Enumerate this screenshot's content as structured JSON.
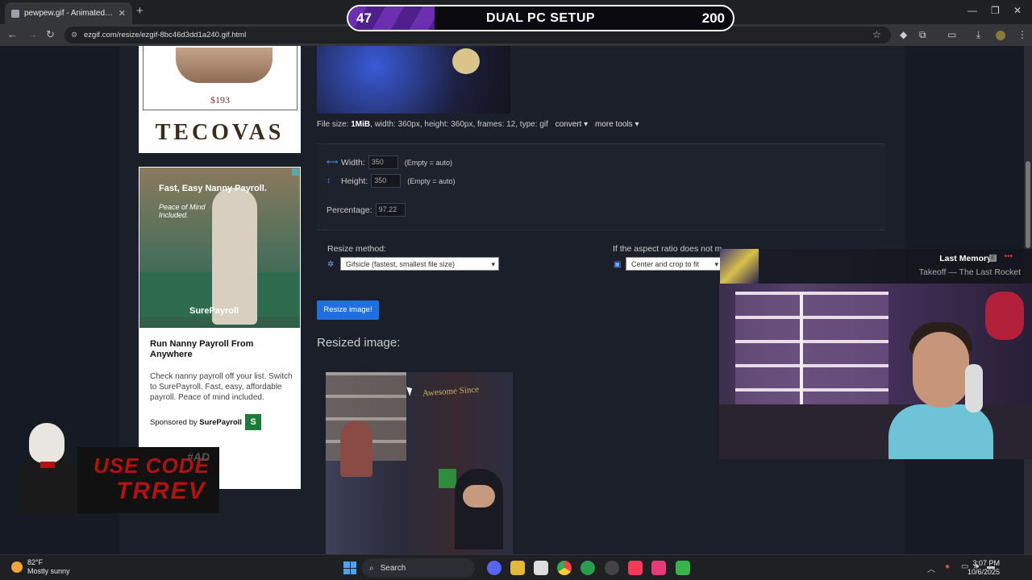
{
  "browser": {
    "tab_title": "pewpew.gif - Animated image",
    "url": "ezgif.com/resize/ezgif-8bc46d3dd1a240.gif.html",
    "newtab_glyph": "+",
    "close_glyph": "✕"
  },
  "stream_overlay": {
    "left_score": "47",
    "title": "DUAL PC SETUP",
    "right_score": "200",
    "progress": 0.225
  },
  "ads": {
    "boot_price": "$193",
    "tecovas": "TECOVAS",
    "surepayroll_headline": "Fast, Easy Nanny Payroll.",
    "surepayroll_sub": "Peace of Mind Included.",
    "surepayroll_brand": "SurePayroll",
    "card_title": "Run Nanny Payroll From Anywhere",
    "card_body": "Check nanny payroll off your list. Switch to SurePayroll. Fast, easy, affordable payroll. Peace of mind included.",
    "sponsored_prefix": "Sponsored by",
    "sponsored_brand": "SurePayroll"
  },
  "file_info": {
    "prefix": "File size:",
    "size": "1MiB",
    "rest": ", width: 360px, height: 360px, frames: 12, type: gif",
    "convert": "convert",
    "more_tools": "more tools"
  },
  "form": {
    "width_label": "Width:",
    "width_value": "350",
    "height_label": "Height:",
    "height_value": "350",
    "empty_hint": "(Empty = auto)",
    "percentage_label": "Percentage:",
    "percentage_value": "97.22",
    "resize_method_label": "Resize method:",
    "resize_method_value": "Gifsicle (fastest, smallest file size)",
    "aspect_label": "If the aspect ratio does not match",
    "aspect_value": "Center and crop to fit",
    "resize_button": "Resize image!"
  },
  "result": {
    "heading": "Resized image:",
    "overlay_text": "Awesome Since"
  },
  "now_playing": {
    "title": "Last Memory",
    "explicit": "E",
    "artist": "Takeoff — The Last Rocket"
  },
  "promo": {
    "line1": "USE CODE",
    "line2": "TRREV",
    "tag": "#AD"
  },
  "taskbar": {
    "temperature": "82°F",
    "weather": "Mostly sunny",
    "search": "Search",
    "time": "3:07 PM",
    "date": "10/6/2025"
  }
}
